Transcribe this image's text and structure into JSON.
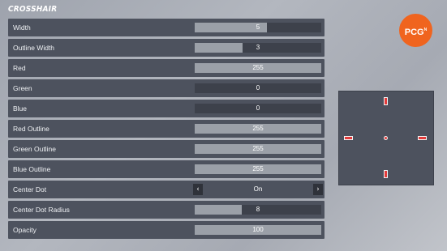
{
  "title": "CROSSHAIR",
  "settings": [
    {
      "label": "Width",
      "value": "5",
      "fill": 0.57
    },
    {
      "label": "Outline Width",
      "value": "3",
      "fill": 0.38
    },
    {
      "label": "Red",
      "value": "255",
      "fill": 1.0
    },
    {
      "label": "Green",
      "value": "0",
      "fill": 0.0
    },
    {
      "label": "Blue",
      "value": "0",
      "fill": 0.0
    },
    {
      "label": "Red Outline",
      "value": "255",
      "fill": 1.0
    },
    {
      "label": "Green Outline",
      "value": "255",
      "fill": 1.0
    },
    {
      "label": "Blue Outline",
      "value": "255",
      "fill": 1.0
    },
    {
      "label": "Center Dot",
      "value": "On",
      "left_arrow": "‹",
      "right_arrow": "›"
    },
    {
      "label": "Center Dot Radius",
      "value": "8",
      "fill": 0.37
    },
    {
      "label": "Opacity",
      "value": "100",
      "fill": 1.0
    }
  ],
  "logo": {
    "text": "PCG",
    "superscript": "N"
  },
  "colors": {
    "crosshair": "#e33b3b",
    "outline": "#f3f3f3",
    "panel": "#4d525e",
    "logo": "#f0641e"
  }
}
